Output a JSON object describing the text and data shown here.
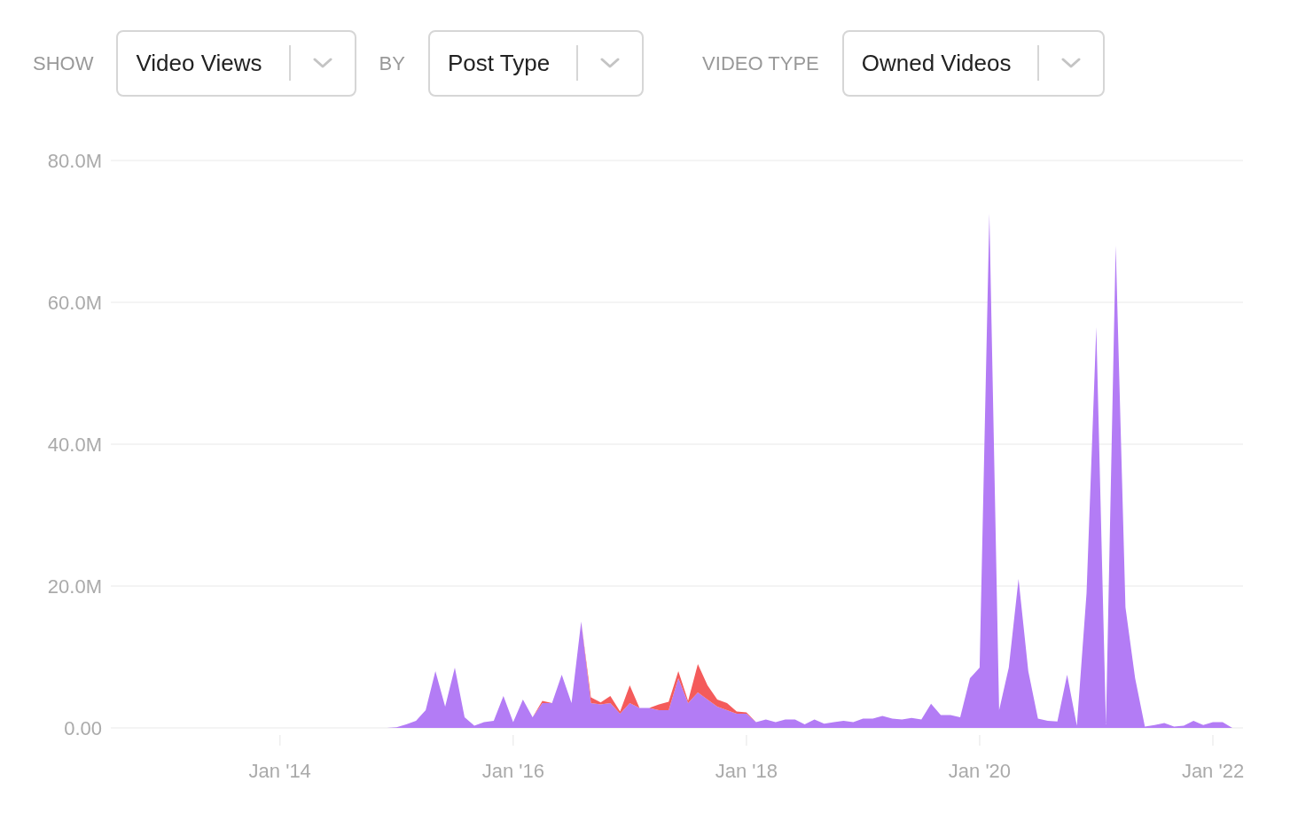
{
  "filters": [
    {
      "label": "SHOW",
      "value": "Video Views"
    },
    {
      "label": "BY",
      "value": "Post Type"
    },
    {
      "label": "VIDEO TYPE",
      "value": "Owned Videos"
    }
  ],
  "chart": {
    "chart_data": {
      "type": "area",
      "stacked": true,
      "categories": [
        null,
        null,
        null,
        null,
        null,
        null,
        null,
        null,
        null,
        null,
        null,
        null,
        null,
        null,
        null,
        null,
        null,
        "Jan '14",
        null,
        null,
        null,
        null,
        null,
        null,
        null,
        null,
        null,
        null,
        null,
        null,
        null,
        null,
        null,
        null,
        null,
        null,
        null,
        null,
        null,
        null,
        null,
        "Jan '16",
        null,
        null,
        null,
        null,
        null,
        null,
        null,
        null,
        null,
        null,
        null,
        null,
        null,
        null,
        null,
        null,
        null,
        null,
        null,
        null,
        null,
        null,
        null,
        "Jan '18",
        null,
        null,
        null,
        null,
        null,
        null,
        null,
        null,
        null,
        null,
        null,
        null,
        null,
        null,
        null,
        null,
        null,
        null,
        null,
        null,
        null,
        null,
        null,
        "Jan '20",
        null,
        null,
        null,
        null,
        null,
        null,
        null,
        null,
        null,
        null,
        null,
        null,
        null,
        null,
        null,
        null,
        null,
        null,
        null,
        null,
        null,
        null,
        null,
        "Jan '22",
        null,
        null,
        null
      ],
      "series": [
        {
          "color": "#b37cf5",
          "values": [
            null,
            null,
            null,
            null,
            null,
            null,
            null,
            null,
            null,
            null,
            null,
            null,
            null,
            null,
            null,
            null,
            null,
            null,
            null,
            null,
            null,
            null,
            null,
            null,
            null,
            null,
            null,
            null,
            0,
            0.1,
            0.5,
            1,
            2.5,
            8,
            3,
            8.5,
            1.5,
            0.3,
            0.8,
            1,
            4.5,
            0.8,
            4,
            1.5,
            3.5,
            3.5,
            7.5,
            3.5,
            15,
            3.5,
            3.3,
            3.5,
            2,
            3.5,
            2.8,
            2.8,
            2.5,
            2.5,
            7,
            3.5,
            5,
            4,
            3,
            2.5,
            2,
            2,
            0.8,
            1.2,
            0.8,
            1.2,
            1.2,
            0.5,
            1.2,
            0.6,
            0.8,
            1,
            0.8,
            1.3,
            1.3,
            1.7,
            1.3,
            1.2,
            1.4,
            1.2,
            3.4,
            1.8,
            1.8,
            1.5,
            7,
            8.5,
            72.5,
            2.5,
            8.5,
            21,
            8,
            1.3,
            1,
            0.9,
            7.5,
            0.3,
            19,
            56.5,
            0.5,
            68,
            17,
            7,
            0.2,
            0.4,
            0.7,
            0.2,
            0.3,
            1,
            0.4,
            0.8,
            0.8,
            0,
            null
          ]
        },
        {
          "color": "#f45b5b",
          "values": [
            null,
            null,
            null,
            null,
            null,
            null,
            null,
            null,
            null,
            null,
            null,
            null,
            null,
            null,
            null,
            null,
            null,
            null,
            null,
            null,
            null,
            null,
            null,
            null,
            null,
            null,
            null,
            null,
            null,
            null,
            null,
            null,
            null,
            null,
            null,
            null,
            null,
            null,
            null,
            null,
            null,
            null,
            null,
            0,
            0.3,
            0,
            0,
            0,
            0,
            0.8,
            0.3,
            1,
            0.3,
            2.5,
            0,
            0,
            0.8,
            1.2,
            1,
            0.3,
            4,
            2,
            1,
            1,
            0.3,
            0.2,
            0,
            null,
            null,
            null,
            null,
            null,
            null,
            null,
            null,
            null,
            null,
            null,
            null,
            null,
            null,
            null,
            null,
            null,
            null,
            null,
            null,
            null,
            null,
            null,
            null,
            null,
            null,
            null,
            null,
            null,
            null,
            null,
            null,
            null,
            null,
            null,
            null,
            null,
            null,
            null,
            null,
            null,
            null,
            null,
            null,
            null,
            null,
            null,
            null,
            null,
            null
          ]
        }
      ],
      "grid": true,
      "ylim": [
        0,
        80
      ],
      "yticks": [
        {
          "value": 0,
          "label": "0.00"
        },
        {
          "value": 20,
          "label": "20.0M"
        },
        {
          "value": 40,
          "label": "40.0M"
        },
        {
          "value": 60,
          "label": "60.0M"
        },
        {
          "value": 80,
          "label": "80.0M"
        }
      ]
    }
  }
}
